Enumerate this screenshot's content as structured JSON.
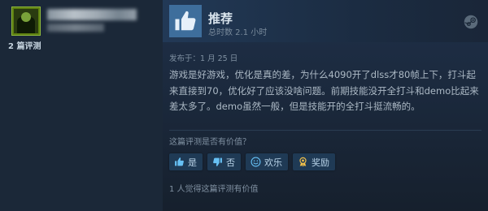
{
  "author": {
    "review_count": "2 篇评测"
  },
  "review": {
    "verdict": "推荐",
    "playtime": "总时数 2.1 小时",
    "posted": "发布于：1 月 25 日",
    "body": "游戏是好游戏，优化是真的差，为什么4090开了dlss才80帧上下，打斗起来直接到70，优化好了应该没啥问题。前期技能没开全打斗和demo比起来差太多了。demo虽然一般，但是技能开的全打斗挺流畅的。",
    "helpful_question": "这篇评测是否有价值？",
    "buttons": {
      "yes": "是",
      "no": "否",
      "funny": "欢乐",
      "award": "奖励"
    },
    "helpful_count": "1 人觉得这篇评测有价值"
  },
  "colors": {
    "background": "#1b2838",
    "thumb_box": "#3e6e9c",
    "button": "#1f3a55",
    "button_icon": "#67c1f5"
  },
  "icons": {
    "avatar": "avatar",
    "thumb": "thumbs-up-icon",
    "platform": "steam-icon",
    "yes": "thumbs-up-icon",
    "no": "thumbs-down-icon",
    "funny": "smiley-icon",
    "award": "award-icon"
  }
}
